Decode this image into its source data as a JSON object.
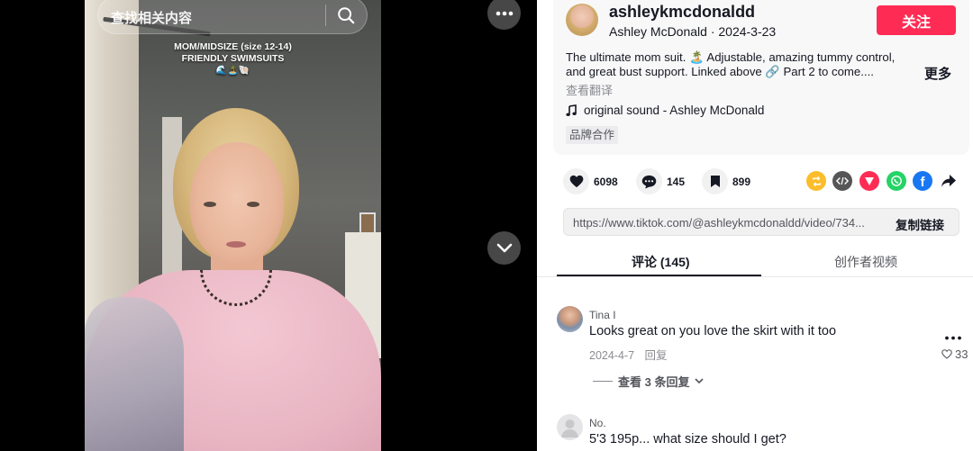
{
  "video": {
    "search_placeholder": "查找相关内容",
    "caption_line1": "MOM/MIDSIZE (size 12-14)",
    "caption_line2": "FRIENDLY SWIMSUITS",
    "caption_emojis": "🌊🏝️🐚"
  },
  "author": {
    "username": "ashleykmcdonaldd",
    "subline": "Ashley McDonald · 2024-3-23",
    "follow_label": "关注"
  },
  "post": {
    "description": "The ultimate mom suit. 🏝️ Adjustable, amazing tummy control, and great bust support. Linked above 🔗 Part 2 to come....",
    "more_label": "更多",
    "translate_label": "查看翻译",
    "sound": "original sound - Ashley McDonald",
    "brand_tag": "品牌合作"
  },
  "stats": {
    "likes": "6098",
    "comments": "145",
    "saves": "899"
  },
  "share": {
    "icons": [
      "repost-icon",
      "embed-icon",
      "send-icon",
      "whatsapp-icon",
      "facebook-icon",
      "share-arrow-icon"
    ],
    "colors": [
      "#fbbd2c",
      "#565656",
      "#fe2c55",
      "#25d366",
      "#1877f2",
      "#161823"
    ]
  },
  "link": {
    "url": "https://www.tiktok.com/@ashleykmcdonaldd/video/734...",
    "copy_label": "复制链接"
  },
  "tabs": {
    "comments": "评论 (145)",
    "creator_videos": "创作者视频"
  },
  "comments": [
    {
      "name": "Tina I",
      "text": "Looks great on you love the skirt with it too",
      "date": "2024-4-7",
      "reply_label": "回复",
      "likes": "33",
      "view_replies": "查看 3 条回复"
    },
    {
      "name": "No.",
      "text": "5'3 195p... what size should I get?"
    }
  ],
  "colors": {
    "accent": "#fe2c55",
    "text": "#161823"
  }
}
